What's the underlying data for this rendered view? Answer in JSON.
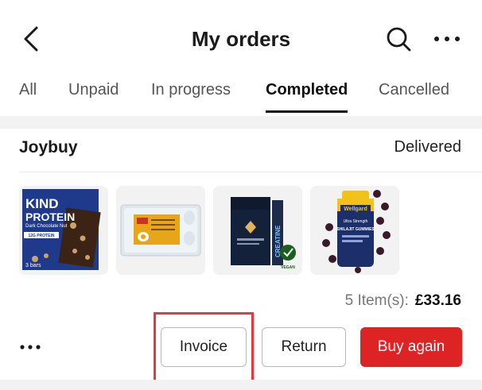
{
  "header": {
    "title": "My orders",
    "back_icon": "chevron-left-icon",
    "search_icon": "search-icon",
    "more_icon": "more-horizontal-icon"
  },
  "tabs": [
    {
      "label": "All",
      "active": false
    },
    {
      "label": "Unpaid",
      "active": false
    },
    {
      "label": "In progress",
      "active": false
    },
    {
      "label": "Completed",
      "active": true
    },
    {
      "label": "Cancelled",
      "active": false
    }
  ],
  "order": {
    "seller": "Joybuy",
    "status": "Delivered",
    "products": [
      {
        "label_line1": "KIND",
        "label_line2": "PROTEIN",
        "label_line3": "Dark Chocolate Nut",
        "badge": "12G PROTEIN",
        "footer": "3 bars"
      },
      {
        "icon": "egg-box-image"
      },
      {
        "label_line1": "CREATINE",
        "badge": "VEGAN",
        "icon": "supplement-pack-image"
      },
      {
        "label_line1": "Wellgard",
        "label_line2": "Ultra Strength",
        "label_line3": "SHILAJIT GUMMIES",
        "icon": "gummies-bottle-image"
      }
    ],
    "item_count": "5 Item(s):",
    "total": "£33.16",
    "actions": {
      "more_icon": "more-horizontal-icon",
      "invoice": "Invoice",
      "return": "Return",
      "buy_again": "Buy again"
    }
  },
  "colors": {
    "accent": "#dd2323",
    "highlight": "#e8383d",
    "text_primary": "#1a1a1a",
    "text_secondary": "#777777",
    "band_gray": "#f2f2f2"
  }
}
